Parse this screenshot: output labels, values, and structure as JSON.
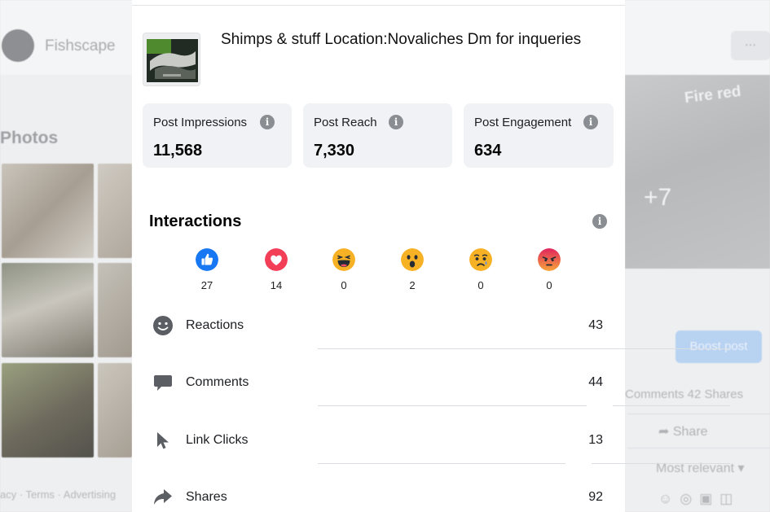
{
  "background": {
    "page_name": "Fishscape",
    "photos_heading": "Photos",
    "more_label": "···",
    "photo_caption": "Fire red",
    "photo_more_count": "+7",
    "boost_label": "Boost post",
    "engagement_summary": "Comments 42 Shares",
    "share_label": "Share",
    "sort_label": "Most relevant",
    "footer_text": "acy · Terms · Advertising"
  },
  "post": {
    "title": "Shimps & stuff Location:Novaliches Dm for inqueries"
  },
  "metrics": [
    {
      "label": "Post Impressions",
      "value": "11,568"
    },
    {
      "label": "Post Reach",
      "value": "7,330"
    },
    {
      "label": "Post Engagement",
      "value": "634"
    }
  ],
  "interactions": {
    "title": "Interactions",
    "reactions": [
      {
        "icon": "like-icon",
        "count": "27",
        "color": "#1877f2"
      },
      {
        "icon": "love-icon",
        "count": "14",
        "color": "#f33e58"
      },
      {
        "icon": "haha-icon",
        "count": "0",
        "color": "#f7b125"
      },
      {
        "icon": "wow-icon",
        "count": "2",
        "color": "#f7b125"
      },
      {
        "icon": "sad-icon",
        "count": "0",
        "color": "#f7b125"
      },
      {
        "icon": "angry-icon",
        "count": "0",
        "color": "#e9710f"
      }
    ],
    "rows": [
      {
        "icon": "smiley-icon",
        "label": "Reactions",
        "value": "43"
      },
      {
        "icon": "comment-icon",
        "label": "Comments",
        "value": "44"
      },
      {
        "icon": "cursor-icon",
        "label": "Link Clicks",
        "value": "13"
      },
      {
        "icon": "share-icon",
        "label": "Shares",
        "value": "92"
      }
    ]
  }
}
